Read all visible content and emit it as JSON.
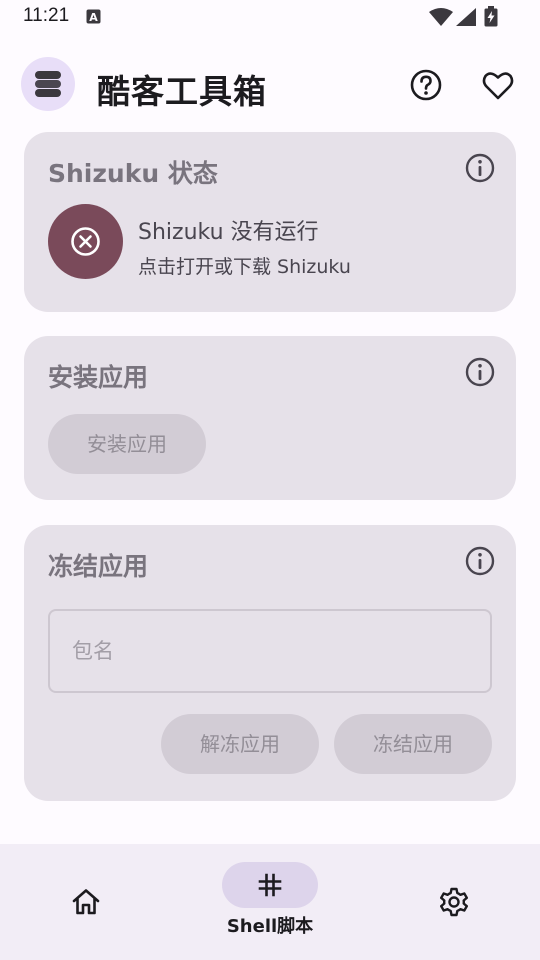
{
  "status_bar": {
    "time": "11:21"
  },
  "app_bar": {
    "title": "酷客工具箱",
    "icons": [
      "layers-logo-icon",
      "help-circle-icon",
      "heart-icon"
    ]
  },
  "shizuku_card": {
    "title": "Shizuku 状态",
    "status_title": "Shizuku 没有运行",
    "status_subtitle": "点击打开或下载 Shizuku",
    "status_color": "#7a4a5a"
  },
  "install_card": {
    "title": "安装应用",
    "install_button": "安装应用"
  },
  "freeze_card": {
    "title": "冻结应用",
    "package_placeholder": "包名",
    "package_value": "",
    "unfreeze_button": "解冻应用",
    "freeze_button": "冻结应用"
  },
  "bottom_nav": {
    "items": [
      {
        "icon": "home-icon",
        "label": ""
      },
      {
        "icon": "hash-icon",
        "label": "Shell脚本",
        "selected": true
      },
      {
        "icon": "gear-icon",
        "label": ""
      }
    ]
  },
  "colors": {
    "background": "#fefbff",
    "card": "#e6e1e9",
    "accent_container": "#e8def8",
    "disabled_button": "#d2ccd5"
  }
}
